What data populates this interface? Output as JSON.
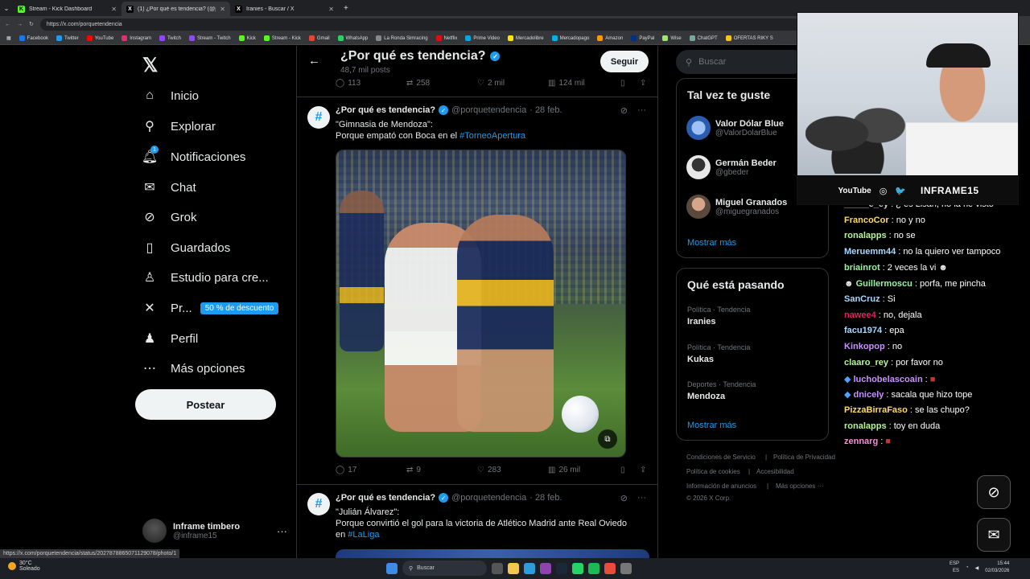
{
  "browser": {
    "tabs": [
      {
        "title": "Stream - Kick Dashboard",
        "icon": "K",
        "color": "#53fc18"
      },
      {
        "title": "(1) ¿Por qué es tendencia? (@porq",
        "icon": "X",
        "color": "#ffffff"
      },
      {
        "title": "Iranies - Buscar / X",
        "icon": "X",
        "color": "#ffffff"
      }
    ],
    "url": "https://x.com/porquetendencia",
    "bookmarks": [
      "Facebook",
      "Twitter",
      "YouTube",
      "Instagram",
      "Twitch",
      "Stream - Twitch",
      "Kick",
      "Stream - Kick",
      "Gmail",
      "WhatsApp",
      "La Ronda Simracing",
      "Netflix",
      "Prime Video",
      "Mercadolibre",
      "Mercadopago",
      "Amazon",
      "PayPal",
      "Wise",
      "ChatGPT",
      "OFERTAS RIKY S"
    ],
    "status_url": "https://x.com/porquetendencia/status/2027878865071129078/photo/1"
  },
  "nav": {
    "items": [
      {
        "label": "Inicio",
        "icon": "home-icon",
        "glyph": "⌂"
      },
      {
        "label": "Explorar",
        "icon": "search-icon",
        "glyph": "⚲"
      },
      {
        "label": "Notificaciones",
        "icon": "bell-icon",
        "glyph": "♫"
      },
      {
        "label": "Chat",
        "icon": "mail-icon",
        "glyph": "✉"
      },
      {
        "label": "Grok",
        "icon": "grok-icon",
        "glyph": "⊘"
      },
      {
        "label": "Guardados",
        "icon": "bookmark-icon",
        "glyph": "⚐"
      },
      {
        "label": "Estudio para cre...",
        "icon": "flask-icon",
        "glyph": "♙"
      },
      {
        "label": "Pr...",
        "icon": "x-premium-icon",
        "glyph": "✕"
      },
      {
        "label": "Perfil",
        "icon": "person-icon",
        "glyph": "♟"
      },
      {
        "label": "Más opciones",
        "icon": "more-circle-icon",
        "glyph": "⋯"
      }
    ],
    "notif_count": "1",
    "promo": "50 % de descuento",
    "post": "Postear",
    "account_name": "Inframe timbero",
    "account_handle": "@inframe15"
  },
  "profile": {
    "title": "¿Por qué es tendencia?",
    "posts": "48,7 mil posts",
    "follow": "Seguir"
  },
  "top_actions": {
    "replies": "113",
    "reposts": "258",
    "likes": "2 mil",
    "views": "124 mil"
  },
  "tweets": [
    {
      "name": "¿Por qué es tendencia?",
      "handle": "@porquetendencia",
      "date": "· 28 feb.",
      "line1": "\"Gimnasia de Mendoza\":",
      "line2": "Porque empató con Boca en el ",
      "hashtag": "#TorneoApertura",
      "replies": "17",
      "reposts": "9",
      "likes": "283",
      "views": "26 mil"
    },
    {
      "name": "¿Por qué es tendencia?",
      "handle": "@porquetendencia",
      "date": "· 28 feb.",
      "line1": "\"Julián Álvarez\":",
      "line2": "Porque convirtió el gol para la victoria de Atlético Madrid ante Real Oviedo",
      "line3": "en ",
      "hashtag": "#LaLiga"
    }
  ],
  "right": {
    "search_placeholder": "Buscar",
    "wtf_title": "Tal vez te guste",
    "wtf": [
      {
        "name": "Valor Dólar Blue",
        "handle": "@ValorDolarBlue",
        "color": "#2a5db0"
      },
      {
        "name": "Germán Beder",
        "handle": "@gbeder",
        "color": "#e8e8e8"
      },
      {
        "name": "Miguel Granados",
        "handle": "@miguegranados",
        "color": "#8a6d5a"
      }
    ],
    "show_more": "Mostrar más",
    "trends_title": "Qué está pasando",
    "trends": [
      {
        "category": "Política · Tendencia",
        "name": "Iranies"
      },
      {
        "category": "Política · Tendencia",
        "name": "Kukas"
      },
      {
        "category": "Deportes · Tendencia",
        "name": "Mendoza"
      }
    ],
    "footer": [
      "Condiciones de Servicio",
      "|",
      "Política de Privacidad",
      "Política de cookies",
      "|",
      "Accesibilidad",
      "Información de anuncios",
      "|",
      "Más opciones ···",
      "© 2026 X Corp."
    ]
  },
  "stream": {
    "socials": [
      "YouTube",
      "◎",
      "🐦"
    ],
    "nick": "INFRAME15"
  },
  "chat": [
    {
      "user": "_____e_ey",
      "text": ": ¿ es Lisan, no la he visto",
      "color": "#d2d2d2"
    },
    {
      "user": "FrancoCor",
      "text": ": no y no",
      "color": "#ffd966"
    },
    {
      "user": "ronalapps",
      "text": ": no se",
      "color": "#b6f59b"
    },
    {
      "user": "Meruemm44",
      "text": ": no la quiero ver tampoco",
      "color": "#a7d8ff"
    },
    {
      "user": "briainrot",
      "text": ": 2 veces la vi",
      "color": "#9cf2a3"
    },
    {
      "user": "Guillermoscu",
      "text": ": porfa, me pincha",
      "color": "#9cf2a3"
    },
    {
      "user": "SanCruz",
      "text": ": Si",
      "color": "#a7d8ff"
    },
    {
      "user": "nawee4",
      "text": ": no, dejala",
      "color": "#e0245e"
    },
    {
      "user": "facu1974",
      "text": ": epa",
      "color": "#a7d8ff"
    },
    {
      "user": "Kinkopop",
      "text": ": no",
      "color": "#c792ff"
    },
    {
      "user": "claaro_rey",
      "text": ": por favor no",
      "color": "#b6f59b"
    },
    {
      "user": "luchobelascoain",
      "text": ":",
      "color": "#c792ff"
    },
    {
      "user": "dnicely",
      "text": ": sacala que hizo tope",
      "color": "#c792ff"
    },
    {
      "user": "PizzaBirraFaso",
      "text": ": se las chupo?",
      "color": "#ffd966"
    },
    {
      "user": "ronalapps",
      "text": ": toy en duda",
      "color": "#b6f59b"
    },
    {
      "user": "zennarg",
      "text": ":",
      "color": "#ff8ad8"
    }
  ],
  "taskbar": {
    "temp": "30°C",
    "weather": "Soleado",
    "search": "Buscar",
    "lang1": "ESP",
    "lang2": "ES",
    "time": "15:44",
    "date": "02/03/2026"
  }
}
